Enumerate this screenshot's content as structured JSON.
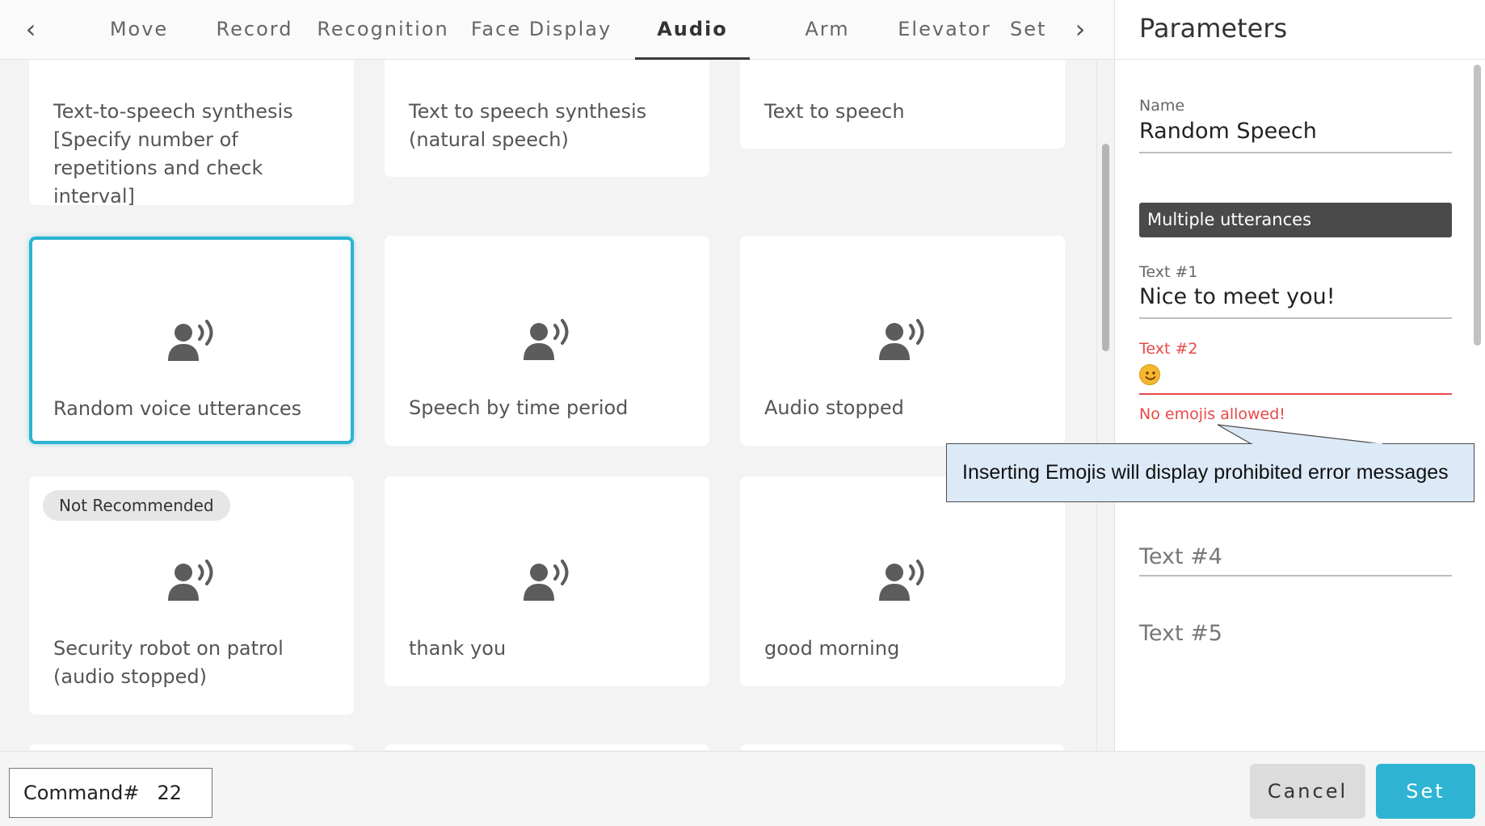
{
  "tabs": {
    "prev_arrow": "‹",
    "next_arrow": "›",
    "items": [
      {
        "label": "Move"
      },
      {
        "label": "Record"
      },
      {
        "label": "Recognition"
      },
      {
        "label": "Face Display"
      },
      {
        "label": "Audio",
        "active": true
      },
      {
        "label": "Arm"
      },
      {
        "label": "Elevator"
      },
      {
        "label": "Set"
      }
    ]
  },
  "cards": [
    {
      "label": "Text-to-speech synthesis [Specify number of repetitions and check interval]"
    },
    {
      "label": "Text to speech synthesis (natural speech)"
    },
    {
      "label": "Text to speech"
    },
    {
      "label": "Random voice utterances",
      "icon": "speaking-person-icon",
      "selected": true
    },
    {
      "label": "Speech by time period",
      "icon": "speaking-person-icon"
    },
    {
      "label": "Audio stopped",
      "icon": "speaking-person-icon"
    },
    {
      "label": "Security robot on patrol (audio stopped)",
      "icon": "speaking-person-icon",
      "badge": "Not Recommended"
    },
    {
      "label": "thank you",
      "icon": "speaking-person-icon"
    },
    {
      "label": "good morning",
      "icon": "speaking-person-icon"
    }
  ],
  "panel": {
    "title": "Parameters",
    "name_label": "Name",
    "name_value": "Random Speech",
    "section_label": "Multiple utterances",
    "text1_label": "Text #1",
    "text1_value": "Nice to meet you!",
    "text2_label": "Text #2",
    "text2_value_icon": "smiling-face-emoji-icon",
    "text2_error": "No emojis allowed!",
    "text4_placeholder": "Text #4",
    "text5_placeholder": "Text #5"
  },
  "callout": {
    "text": "Inserting Emojis will display prohibited error messages"
  },
  "footer": {
    "command_label": "Command#",
    "command_number": "22",
    "cancel_label": "Cancel",
    "set_label": "Set"
  },
  "colors": {
    "accent": "#2eb4d2",
    "selected_border": "#2bb4ce",
    "error": "#e84848",
    "section_bar": "#4a4a4a",
    "callout_bg": "#dce9f7"
  }
}
